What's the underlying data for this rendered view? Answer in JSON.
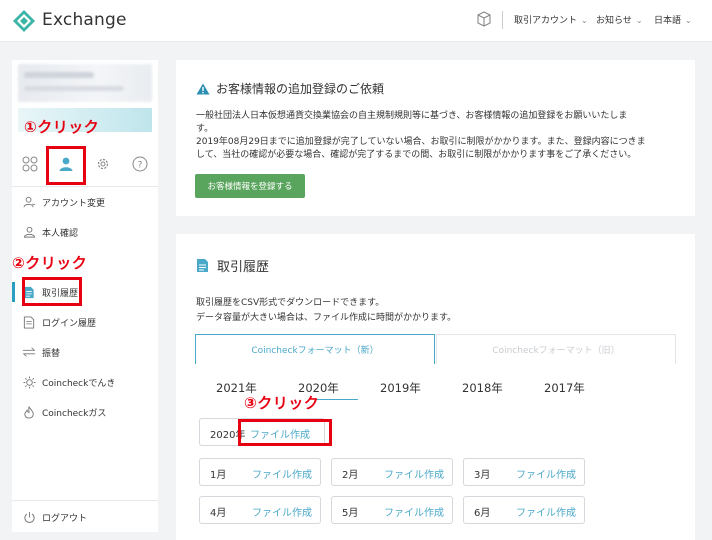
{
  "header": {
    "brand": "Exchange",
    "menus": [
      "取引アカウント",
      "お知らせ",
      "日本語"
    ],
    "chevron": "⌄"
  },
  "annotations": {
    "step1": "①クリック",
    "step2": "②クリック",
    "step3": "③クリック",
    "color": "#e60012"
  },
  "sidebar": {
    "items": [
      {
        "label": "アカウント変更",
        "icon": "user-edit-icon"
      },
      {
        "label": "本人確認",
        "icon": "user-check-icon"
      },
      {
        "label": "取引履歴",
        "icon": "document-icon",
        "active": true
      },
      {
        "label": "ログイン履歴",
        "icon": "file-icon"
      },
      {
        "label": "振替",
        "icon": "transfer-icon"
      },
      {
        "label": "Coincheckでんき",
        "icon": "sun-icon"
      },
      {
        "label": "Coincheckガス",
        "icon": "flame-icon"
      }
    ],
    "logout": "ログアウト"
  },
  "notice": {
    "title": "お客様情報の追加登録のご依頼",
    "p1_l1": "一般社団法人日本仮想通貨交換業協会の自主規制規則等に基づき、お客様情報の追加登録をお願いいたしま",
    "p1_l2": "す。",
    "p2_l1": "2019年08月29日までに追加登録が完了していない場合、お取引に制限がかかります。また、登録内容につきま",
    "p2_l2": "して、当社の確認が必要な場合、確認が完了するまでの間、お取引に制限がかかります事をご了承ください。",
    "button": "お客様情報を登録する",
    "button_color": "#5aa55e"
  },
  "history": {
    "title": "取引履歴",
    "desc1": "取引履歴をCSV形式でダウンロードできます。",
    "desc2": "データ容量が大きい場合は、ファイル作成に時間がかかります。",
    "tabs": [
      "Coincheckフォーマット（新）",
      "Coincheckフォーマット（旧）"
    ],
    "years": [
      "2021年",
      "2020年",
      "2019年",
      "2018年",
      "2017年"
    ],
    "year_all": "2020年",
    "file_label": "ファイル作成",
    "months": [
      "1月",
      "2月",
      "3月",
      "4月",
      "5月",
      "6月"
    ],
    "accent": "#4aa8c8"
  }
}
